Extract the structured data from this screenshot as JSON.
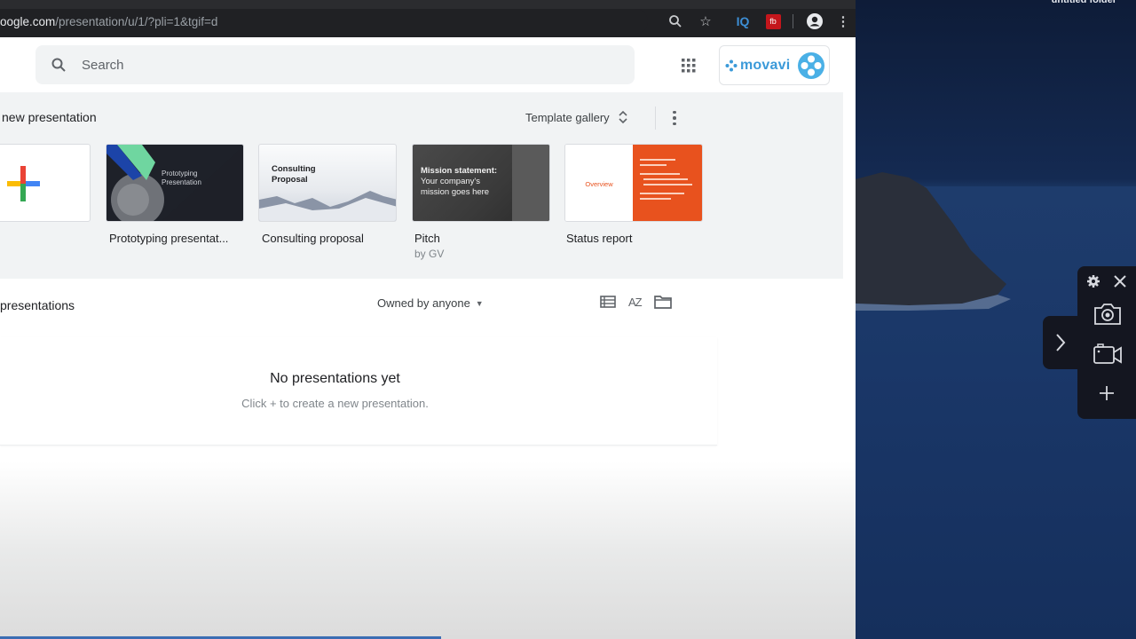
{
  "browser": {
    "url_host": "oogle.com",
    "url_path": "/presentation/u/1/?pli=1&tgif=d",
    "toolbar_icons": [
      "zoom-icon",
      "bookmark-star-icon",
      "iq-extension-icon",
      "red-extension-icon",
      "profile-icon",
      "menu-icon"
    ]
  },
  "header": {
    "search_placeholder": "Search",
    "apps_icon": "apps-grid-icon",
    "brand": "movavi"
  },
  "templates": {
    "heading": "new presentation",
    "gallery_label": "Template gallery",
    "items": [
      {
        "title": "",
        "thumb": "blank"
      },
      {
        "title": "Prototyping presentat...",
        "thumb_text": [
          "Prototyping",
          "Presentation"
        ]
      },
      {
        "title": "Consulting proposal",
        "thumb_text": [
          "Consulting",
          "Proposal"
        ]
      },
      {
        "title": "Pitch",
        "subtitle": "by GV",
        "thumb_text": [
          "Mission statement:",
          "Your company's",
          "mission goes here"
        ]
      },
      {
        "title": "Status report",
        "thumb_text": [
          "Overview"
        ]
      }
    ]
  },
  "recent": {
    "heading": "presentations",
    "owner_filter": "Owned by anyone",
    "empty_title": "No presentations yet",
    "empty_hint": "Click + to create a new presentation."
  },
  "desktop": {
    "folder_label": "untitled folder"
  },
  "recorder": {
    "buttons": [
      "settings",
      "close",
      "screenshot",
      "record-video",
      "add"
    ]
  },
  "progress": {
    "percent": 51.6
  },
  "colors": {
    "accent": "#3b6db3",
    "movavi": "#3b9ad9",
    "status_orange": "#e8521e"
  }
}
